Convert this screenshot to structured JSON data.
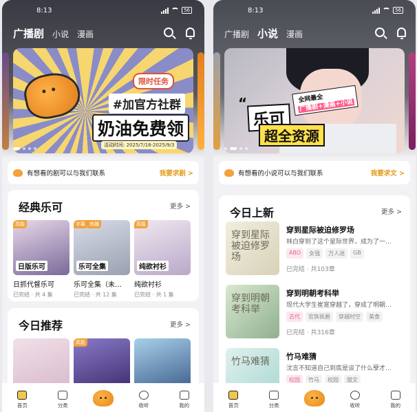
{
  "left": {
    "status": {
      "time": "8:13",
      "battery": "56"
    },
    "tabs": [
      "广播剧",
      "小说",
      "漫画"
    ],
    "active_tab": 0,
    "banner": {
      "tag": "限时任务",
      "line1": "#加官方社群",
      "line2": "奶油免费领",
      "date": "活动时间: 2025/7/18-2025/9/3"
    },
    "notice": {
      "text": "有想看的剧可以与我们联系",
      "action": "我要求剧 >"
    },
    "section1": {
      "title": "经典乐可",
      "more": "更多 >",
      "items": [
        {
          "badge": "高能",
          "badge2": "",
          "cover_text": "日版乐可",
          "name": "日抓代督乐可",
          "meta": "已完结 · 共 4 集"
        },
        {
          "badge": "字幕",
          "badge2": "热播",
          "cover_text": "乐可全集",
          "name": "乐可全集（未…",
          "meta": "已完结 · 共 12 集"
        },
        {
          "badge": "高能",
          "badge2": "",
          "cover_text": "纯欲衬衫",
          "name": "纯欲衬衫",
          "meta": "已完结 · 共 1 集"
        }
      ]
    },
    "section2": {
      "title": "今日推荐",
      "more": "更多 >",
      "items": [
        {
          "badge": "",
          "badge2": ""
        },
        {
          "badge": "高能",
          "badge2": ""
        },
        {
          "badge": "",
          "badge2": ""
        }
      ]
    },
    "nav": [
      "首页",
      "分类",
      "",
      "收听",
      "我的"
    ]
  },
  "right": {
    "status": {
      "time": "8:13",
      "battery": "56"
    },
    "tabs": [
      "广播剧",
      "小说",
      "漫画"
    ],
    "active_tab": 1,
    "banner": {
      "line1": "乐可",
      "line2": "超全资源",
      "tag_prefix": "全网最全",
      "tag_items": "广播剧+漫画+小说"
    },
    "notice": {
      "text": "有想看的小说可以与我们联系",
      "action": "我要求文 >"
    },
    "section": {
      "title": "今日上新",
      "more": "更多 >",
      "items": [
        {
          "title": "穿到星际被迫修罗场",
          "desc": "林白穿到了这个星际世界，成为了一…",
          "tags": [
            "ABO",
            "女强",
            "万人迷",
            "GB"
          ],
          "meta": "已完结 · 共103章",
          "cover_text": "穿到星际被迫修罗场"
        },
        {
          "title": "穿到明朝考科举",
          "desc": "现代大学生崔寔穿越了，穿成了明朝…",
          "tags": [
            "古代",
            "官族侯爵",
            "穿越时空",
            "美食"
          ],
          "meta": "已完结 · 共316章",
          "cover_text": "穿到明朝考科举"
        },
        {
          "title": "竹马难猜",
          "desc": "沈言不知道自己到底是谈了什么孽才…",
          "tags": [
            "校园",
            "竹马",
            "校园",
            "甜文"
          ],
          "meta": "",
          "cover_text": "竹马难猜"
        }
      ]
    },
    "nav": [
      "首页",
      "分类",
      "",
      "收听",
      "我的"
    ]
  },
  "colors": {
    "accent": "#f2a23a",
    "action": "#e49a17",
    "tag_pink": "#e26a8a"
  }
}
